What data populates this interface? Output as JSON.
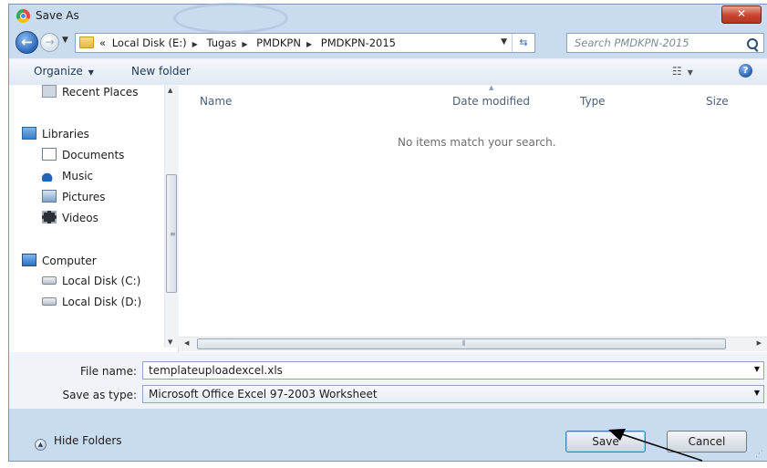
{
  "window": {
    "title": "Save As"
  },
  "nav": {
    "breadcrumb_prefix": "«",
    "breadcrumbs": [
      "Local Disk (E:)",
      "Tugas",
      "PMDKPN",
      "PMDKPN-2015"
    ],
    "search_placeholder": "Search PMDKPN-2015"
  },
  "toolbar": {
    "organize_label": "Organize",
    "new_folder_label": "New folder"
  },
  "sidebar": {
    "items": [
      {
        "label": "Recent Places",
        "icon": "recent-places-icon"
      },
      {
        "label": "Libraries",
        "icon": "libraries-icon"
      },
      {
        "label": "Documents",
        "icon": "documents-icon"
      },
      {
        "label": "Music",
        "icon": "music-icon"
      },
      {
        "label": "Pictures",
        "icon": "pictures-icon"
      },
      {
        "label": "Videos",
        "icon": "videos-icon"
      },
      {
        "label": "Computer",
        "icon": "computer-icon"
      },
      {
        "label": "Local Disk (C:)",
        "icon": "disk-icon"
      },
      {
        "label": "Local Disk (D:)",
        "icon": "disk-icon"
      }
    ]
  },
  "file_list": {
    "columns": [
      "Name",
      "Date modified",
      "Type",
      "Size"
    ],
    "empty_message": "No items match your search."
  },
  "form": {
    "file_name_label": "File name:",
    "file_name_value": "templateuploadexcel.xls",
    "save_type_label": "Save as type:",
    "save_type_value": "Microsoft Office Excel 97-2003 Worksheet"
  },
  "footer": {
    "hide_folders_label": "Hide Folders",
    "save_label": "Save",
    "cancel_label": "Cancel"
  },
  "colors": {
    "window_frame": "#c9dbee",
    "accent": "#3c7fb1",
    "close_button": "#c9452f"
  }
}
